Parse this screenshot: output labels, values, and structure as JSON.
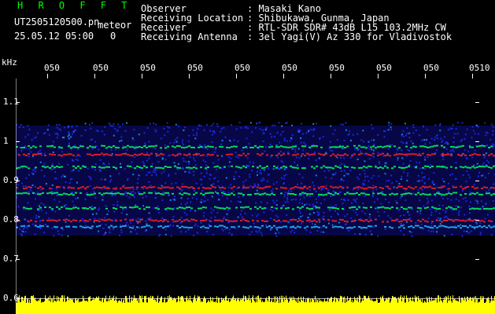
{
  "header": {
    "title": "H R O F F T",
    "filename": "UT2505120500.pn",
    "meteor_label": "meteor",
    "timestamp": "25.05.12 05:00",
    "count": "0",
    "observer_label": "Observer",
    "observer": ": Masaki Kano",
    "location_label": "Receiving Location",
    "location": ": Shibukawa, Gunma, Japan",
    "receiver_label": "Receiver",
    "receiver": ": RTL-SDR SDR# 43dB L15 103.2MHz CW",
    "antenna_label": "Receiving Antenna",
    "antenna": ": 3el Yagi(V) Az 330 for Vladivostok"
  },
  "axis": {
    "unit": "kHz",
    "y_ticks": [
      "1.1",
      "1",
      "0.9",
      "0.8",
      "0.7",
      "0.6"
    ],
    "x_ticks": [
      "050",
      "050",
      "050",
      "050",
      "050",
      "050",
      "050",
      "050",
      "050",
      "0510"
    ]
  },
  "colors": {
    "title": "#00ff00",
    "background": "#000000",
    "signal_hot": "#ff2020",
    "signal_mid": "#00ff60",
    "noise": "#1010a0",
    "level": "#ffff00"
  }
}
